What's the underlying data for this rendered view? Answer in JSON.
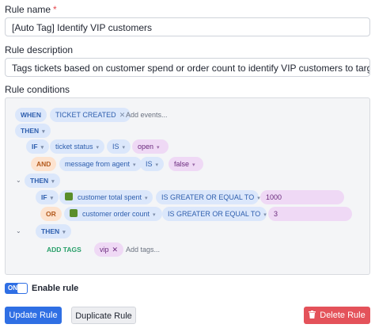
{
  "form": {
    "rule_name_label": "Rule name",
    "required_mark": "*",
    "rule_name_value": "[Auto Tag] Identify VIP customers",
    "description_label": "Rule description",
    "description_value": "Tags tickets based on customer spend or order count to identify VIP customers to target",
    "conditions_label": "Rule conditions"
  },
  "conditions": {
    "when": "WHEN",
    "event_tag": "TICKET CREATED",
    "add_events_placeholder": "Add events...",
    "then1": "THEN",
    "if1": "IF",
    "field1": "ticket status",
    "op1": "IS",
    "value1": "open",
    "and": "AND",
    "field2": "message from agent",
    "op2": "IS",
    "value2": "false",
    "then2": "THEN",
    "if2": "IF",
    "field3": "customer total spent",
    "op3": "IS GREATER OR EQUAL TO",
    "value3": "1000",
    "or": "OR",
    "field4": "customer order count",
    "op4": "IS GREATER OR EQUAL TO",
    "value4": "3",
    "then3": "THEN",
    "action": "ADD TAGS",
    "tag": "vip",
    "add_tags_placeholder": "Add tags..."
  },
  "toggle": {
    "state_text": "ON",
    "label": "Enable rule"
  },
  "buttons": {
    "update": "Update Rule",
    "duplicate": "Duplicate Rule",
    "delete": "Delete Rule"
  },
  "icons": {
    "remove": "close-icon",
    "dropdown": "chevron-down-icon",
    "shopify": "shopify-icon",
    "trash": "trash-icon",
    "collapse": "caret-down-icon"
  },
  "colors": {
    "primary": "#2f6fe4",
    "danger": "#e4525a",
    "keyword_bg": "#dbe7fb",
    "value_bg": "#efd9f5",
    "or_bg": "#fde3cf"
  }
}
